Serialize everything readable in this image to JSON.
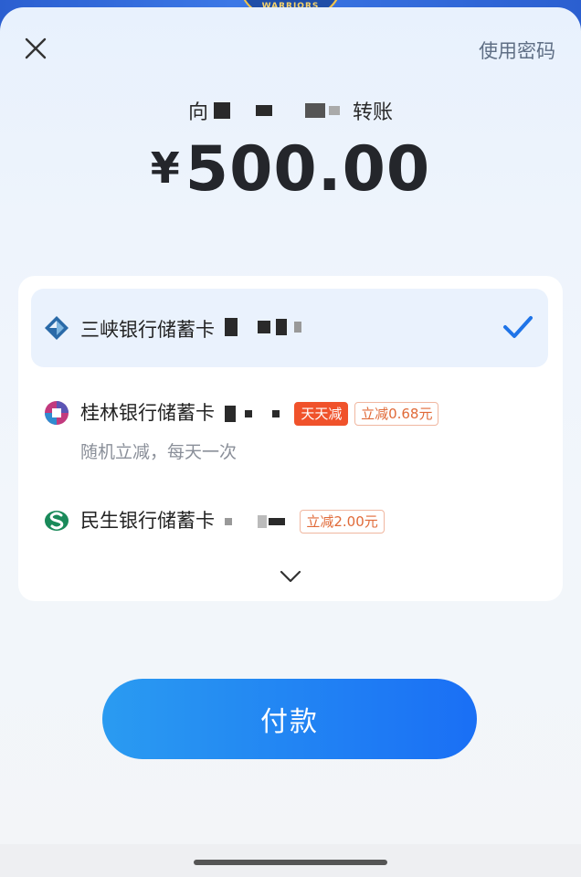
{
  "header": {
    "badge_text": "WARRIORS",
    "use_password_label": "使用密码"
  },
  "transfer": {
    "prefix": "向",
    "suffix": "转账",
    "currency_symbol": "¥",
    "amount": "500.00"
  },
  "cards": [
    {
      "name": "三峡银行储蓄卡",
      "selected": true,
      "icon": "three-gorges-bank-icon"
    },
    {
      "name": "桂林银行储蓄卡",
      "selected": false,
      "icon": "guilin-bank-icon",
      "tags": [
        "天天减",
        "立减0.68元"
      ],
      "note": "随机立减，每天一次"
    },
    {
      "name": "民生银行储蓄卡",
      "selected": false,
      "icon": "minsheng-bank-icon",
      "tags": [
        "立减2.00元"
      ]
    }
  ],
  "pay_button_label": "付款",
  "colors": {
    "accent": "#1a7cf0",
    "tag_red": "#f0522b",
    "tag_outline_text": "#e06a38"
  }
}
